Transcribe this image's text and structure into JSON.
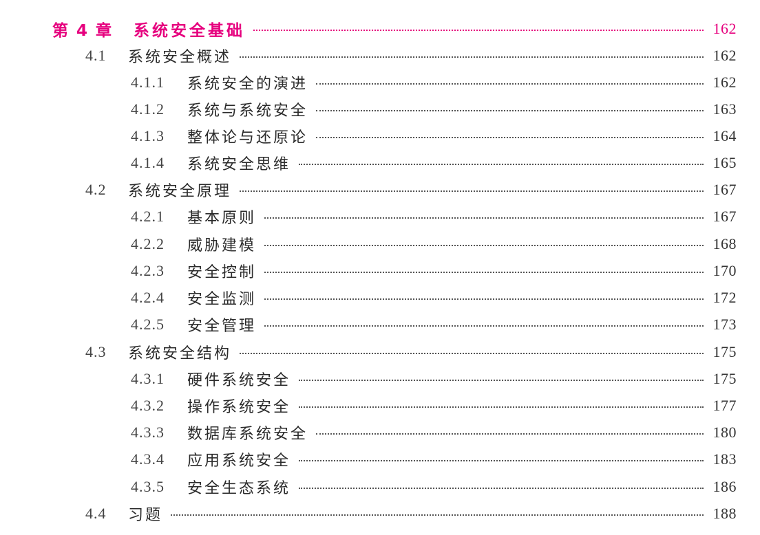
{
  "chapter": {
    "number": "第 4 章",
    "title": "系统安全基础",
    "page": "162"
  },
  "entries": [
    {
      "num": "4.1",
      "title": "系统安全概述",
      "page": "162"
    },
    {
      "num": "4.1.1",
      "title": "系统安全的演进",
      "page": "162"
    },
    {
      "num": "4.1.2",
      "title": "系统与系统安全",
      "page": "163"
    },
    {
      "num": "4.1.3",
      "title": "整体论与还原论",
      "page": "164"
    },
    {
      "num": "4.1.4",
      "title": "系统安全思维",
      "page": "165"
    },
    {
      "num": "4.2",
      "title": "系统安全原理",
      "page": "167"
    },
    {
      "num": "4.2.1",
      "title": "基本原则",
      "page": "167"
    },
    {
      "num": "4.2.2",
      "title": "威胁建模",
      "page": "168"
    },
    {
      "num": "4.2.3",
      "title": "安全控制",
      "page": "170"
    },
    {
      "num": "4.2.4",
      "title": "安全监测",
      "page": "172"
    },
    {
      "num": "4.2.5",
      "title": "安全管理",
      "page": "173"
    },
    {
      "num": "4.3",
      "title": "系统安全结构",
      "page": "175"
    },
    {
      "num": "4.3.1",
      "title": "硬件系统安全",
      "page": "175"
    },
    {
      "num": "4.3.2",
      "title": "操作系统安全",
      "page": "177"
    },
    {
      "num": "4.3.3",
      "title": "数据库系统安全",
      "page": "180"
    },
    {
      "num": "4.3.4",
      "title": "应用系统安全",
      "page": "183"
    },
    {
      "num": "4.3.5",
      "title": "安全生态系统",
      "page": "186"
    },
    {
      "num": "4.4",
      "title": "习题",
      "page": "188"
    }
  ],
  "colors": {
    "chapter_accent": "#e6007e",
    "body_text": "#2b2b2b"
  }
}
